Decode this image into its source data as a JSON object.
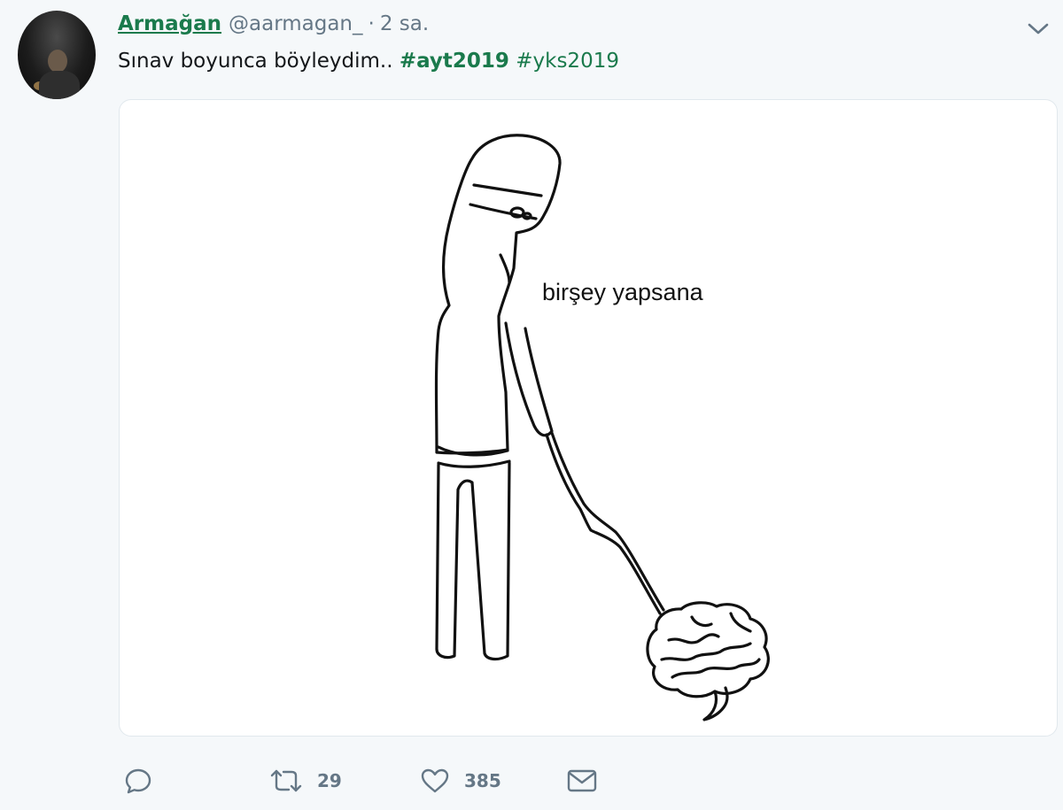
{
  "tweet": {
    "display_name": "Armağan",
    "handle": "@aarmagan_",
    "separator": "·",
    "time": "2 sa.",
    "text_prefix": "Sınav boyunca böyleydim.. ",
    "hashtags": [
      "#ayt2019",
      "#yks2019"
    ],
    "media": {
      "caption": "birşey yapsana"
    },
    "actions": {
      "reply_count": "",
      "retweet_count": "29",
      "like_count": "385"
    }
  },
  "colors": {
    "accent": "#1a7a4c",
    "muted": "#657786",
    "background": "#f5f8fa"
  },
  "icons": [
    "chevron-down-icon",
    "reply-icon",
    "retweet-icon",
    "like-icon",
    "message-icon"
  ]
}
